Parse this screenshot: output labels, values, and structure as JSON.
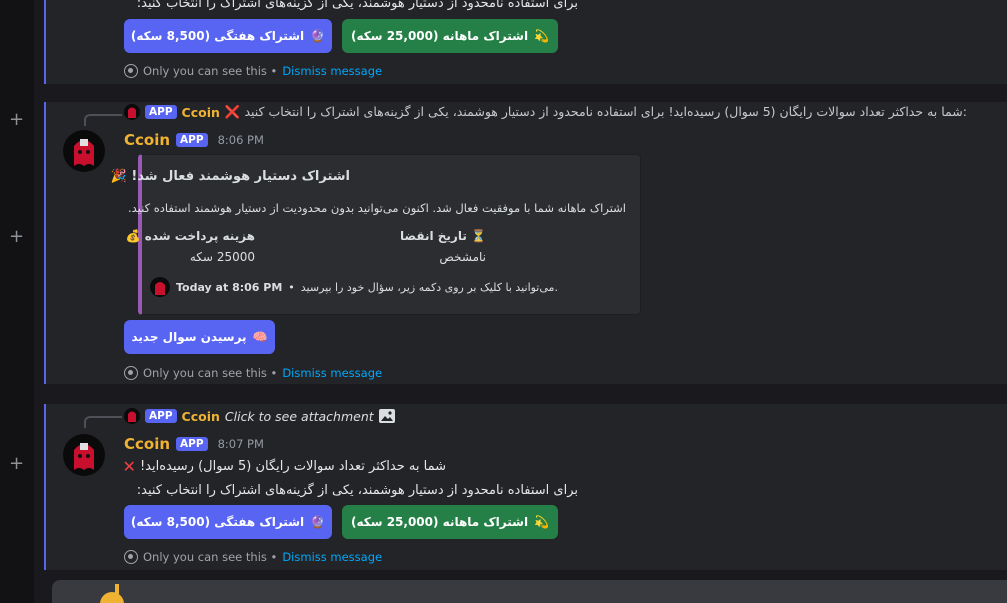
{
  "texts": {
    "top_line": "برای استفاده نامحدود از دستیار هوشمند، یکی از گزینه‌های اشتراک را انتخاب کنید:",
    "limit_line": "شما به حداکثر تعداد سوالات رایگان (5 سوال) رسیده‌اید!",
    "choose_line": "برای استفاده نامحدود از دستیار هوشمند، یکی از گزینه‌های اشتراک را انتخاب کنید:"
  },
  "buttons": {
    "weekly": "اشتراک هفتگی (8,500 سکه)",
    "monthly": "اشتراک ماهانه (25,000 سکه)",
    "ask_new": "پرسیدن سوال جدید"
  },
  "ephemeral": {
    "only_you": "Only you can see this •",
    "dismiss": "Dismiss message"
  },
  "bot": {
    "name": "Ccoin",
    "badge": "APP"
  },
  "msg2": {
    "reply_text": "❌ شما به حداکثر تعداد سوالات رایگان (5 سوال) رسیده‌اید! برای استفاده نامحدود از دستیار هوشمند، یکی از گزینه‌های اشتراک را انتخاب کنید:",
    "time": "8:06 PM"
  },
  "embed": {
    "title": "اشتراک دستیار هوشمند فعال شد!",
    "desc": "اشتراک ماهانه شما با موفقیت فعال شد. اکنون می‌توانید بدون محدودیت از دستیار هوشمند استفاده کنید.",
    "field1_name": "تاریخ انقضا",
    "field1_value": "نامشخص",
    "field2_name": "هزینه پرداخت شده",
    "field2_value": "25000 سکه",
    "footer": "می‌توانید با کلیک بر روی دکمه زیر، سؤال خود را بپرسید.",
    "footer_time": "Today at 8:06 PM"
  },
  "msg3": {
    "reply_text": "Click to see attachment",
    "time": "8:07 PM"
  },
  "colors": {
    "blurple": "#5865f2",
    "green": "#248046",
    "username": "#f0b232",
    "link": "#00a8fc",
    "embed_bar": "#9b59b6"
  }
}
